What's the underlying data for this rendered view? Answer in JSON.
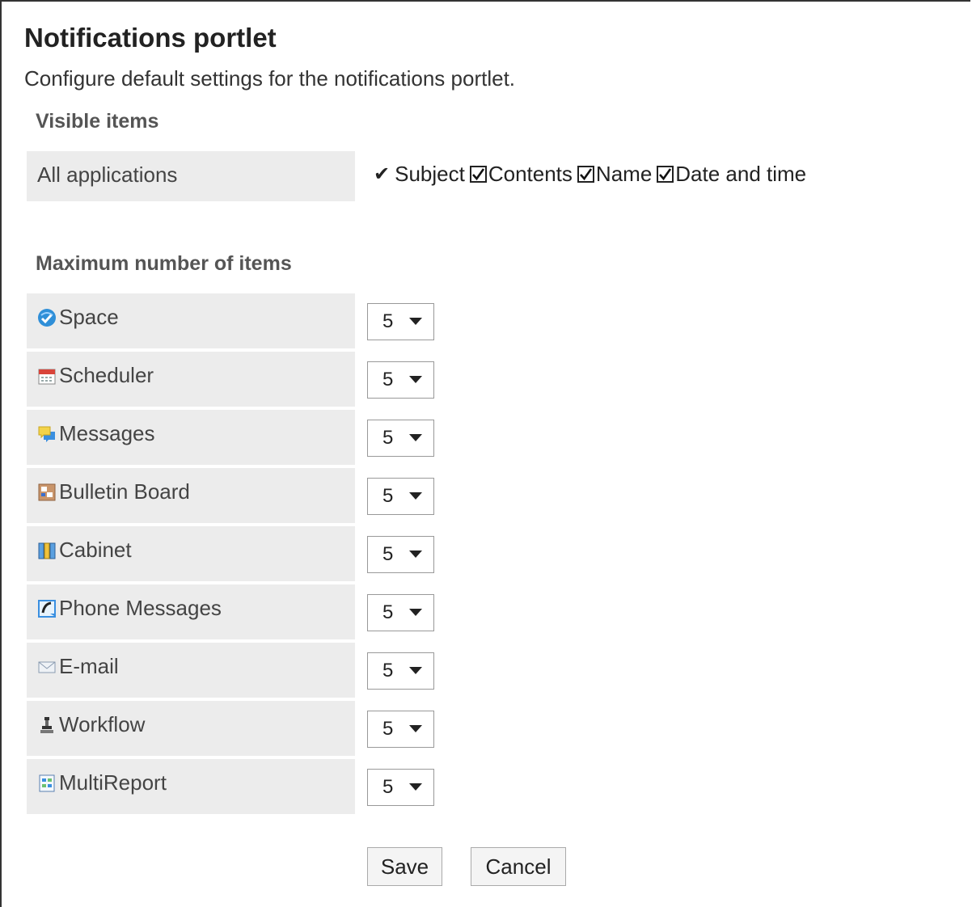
{
  "page": {
    "title": "Notifications portlet",
    "description": "Configure default settings for the notifications portlet."
  },
  "visible_items": {
    "heading": "Visible items",
    "row_label": "All applications",
    "options": [
      {
        "label": "Subject",
        "checked": true,
        "style": "fixed-check"
      },
      {
        "label": "Contents",
        "checked": true,
        "style": "checkbox"
      },
      {
        "label": "Name",
        "checked": true,
        "style": "checkbox"
      },
      {
        "label": "Date and time",
        "checked": true,
        "style": "checkbox"
      }
    ]
  },
  "max_items": {
    "heading": "Maximum number of items",
    "rows": [
      {
        "label": "Space",
        "icon": "space-icon",
        "value": "5"
      },
      {
        "label": "Scheduler",
        "icon": "scheduler-icon",
        "value": "5"
      },
      {
        "label": "Messages",
        "icon": "messages-icon",
        "value": "5"
      },
      {
        "label": "Bulletin Board",
        "icon": "bulletin-board-icon",
        "value": "5"
      },
      {
        "label": "Cabinet",
        "icon": "cabinet-icon",
        "value": "5"
      },
      {
        "label": "Phone Messages",
        "icon": "phone-messages-icon",
        "value": "5"
      },
      {
        "label": "E-mail",
        "icon": "email-icon",
        "value": "5"
      },
      {
        "label": "Workflow",
        "icon": "workflow-icon",
        "value": "5"
      },
      {
        "label": "MultiReport",
        "icon": "multireport-icon",
        "value": "5"
      }
    ]
  },
  "actions": {
    "save_label": "Save",
    "cancel_label": "Cancel"
  },
  "colors": {
    "label_background": "#ececec",
    "heading_text": "#555555"
  }
}
